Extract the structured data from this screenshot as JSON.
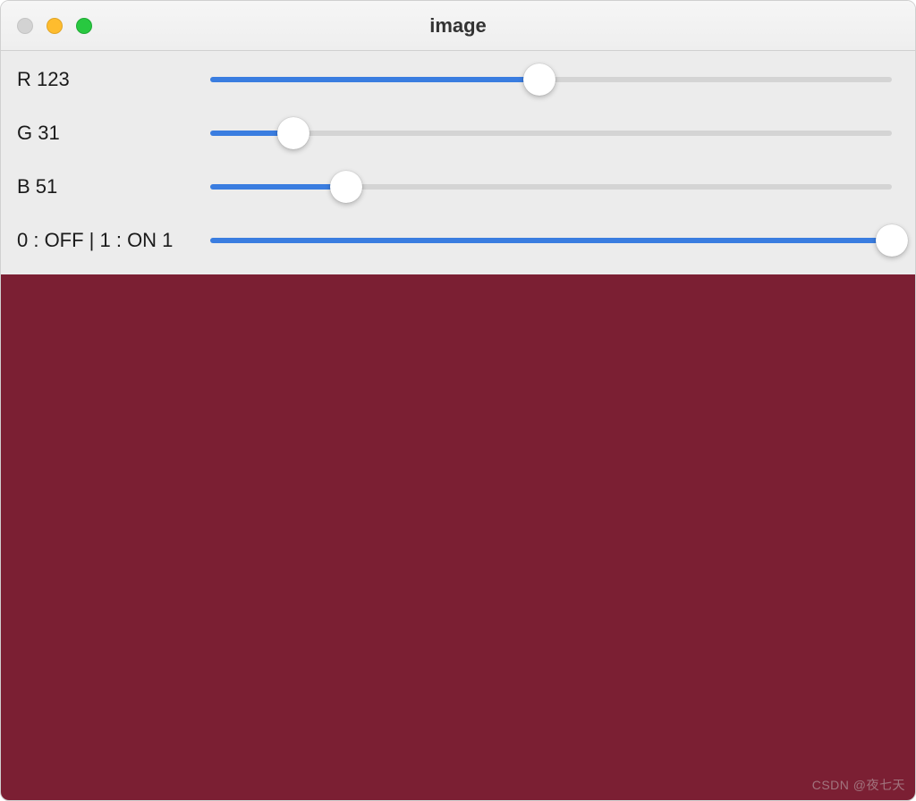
{
  "window": {
    "title": "image"
  },
  "sliders": [
    {
      "name_prefix": "R",
      "value": 123,
      "min": 0,
      "max": 255,
      "label": "R 123"
    },
    {
      "name_prefix": "G",
      "value": 31,
      "min": 0,
      "max": 255,
      "label": "G 31"
    },
    {
      "name_prefix": "B",
      "value": 51,
      "min": 0,
      "max": 255,
      "label": "B 51"
    },
    {
      "name_prefix": "0 : OFF | 1 : ON",
      "value": 1,
      "min": 0,
      "max": 1,
      "label": "0 : OFF | 1 : ON 1"
    }
  ],
  "image": {
    "color": "#7b1f33"
  },
  "watermark": "CSDN @夜七天"
}
